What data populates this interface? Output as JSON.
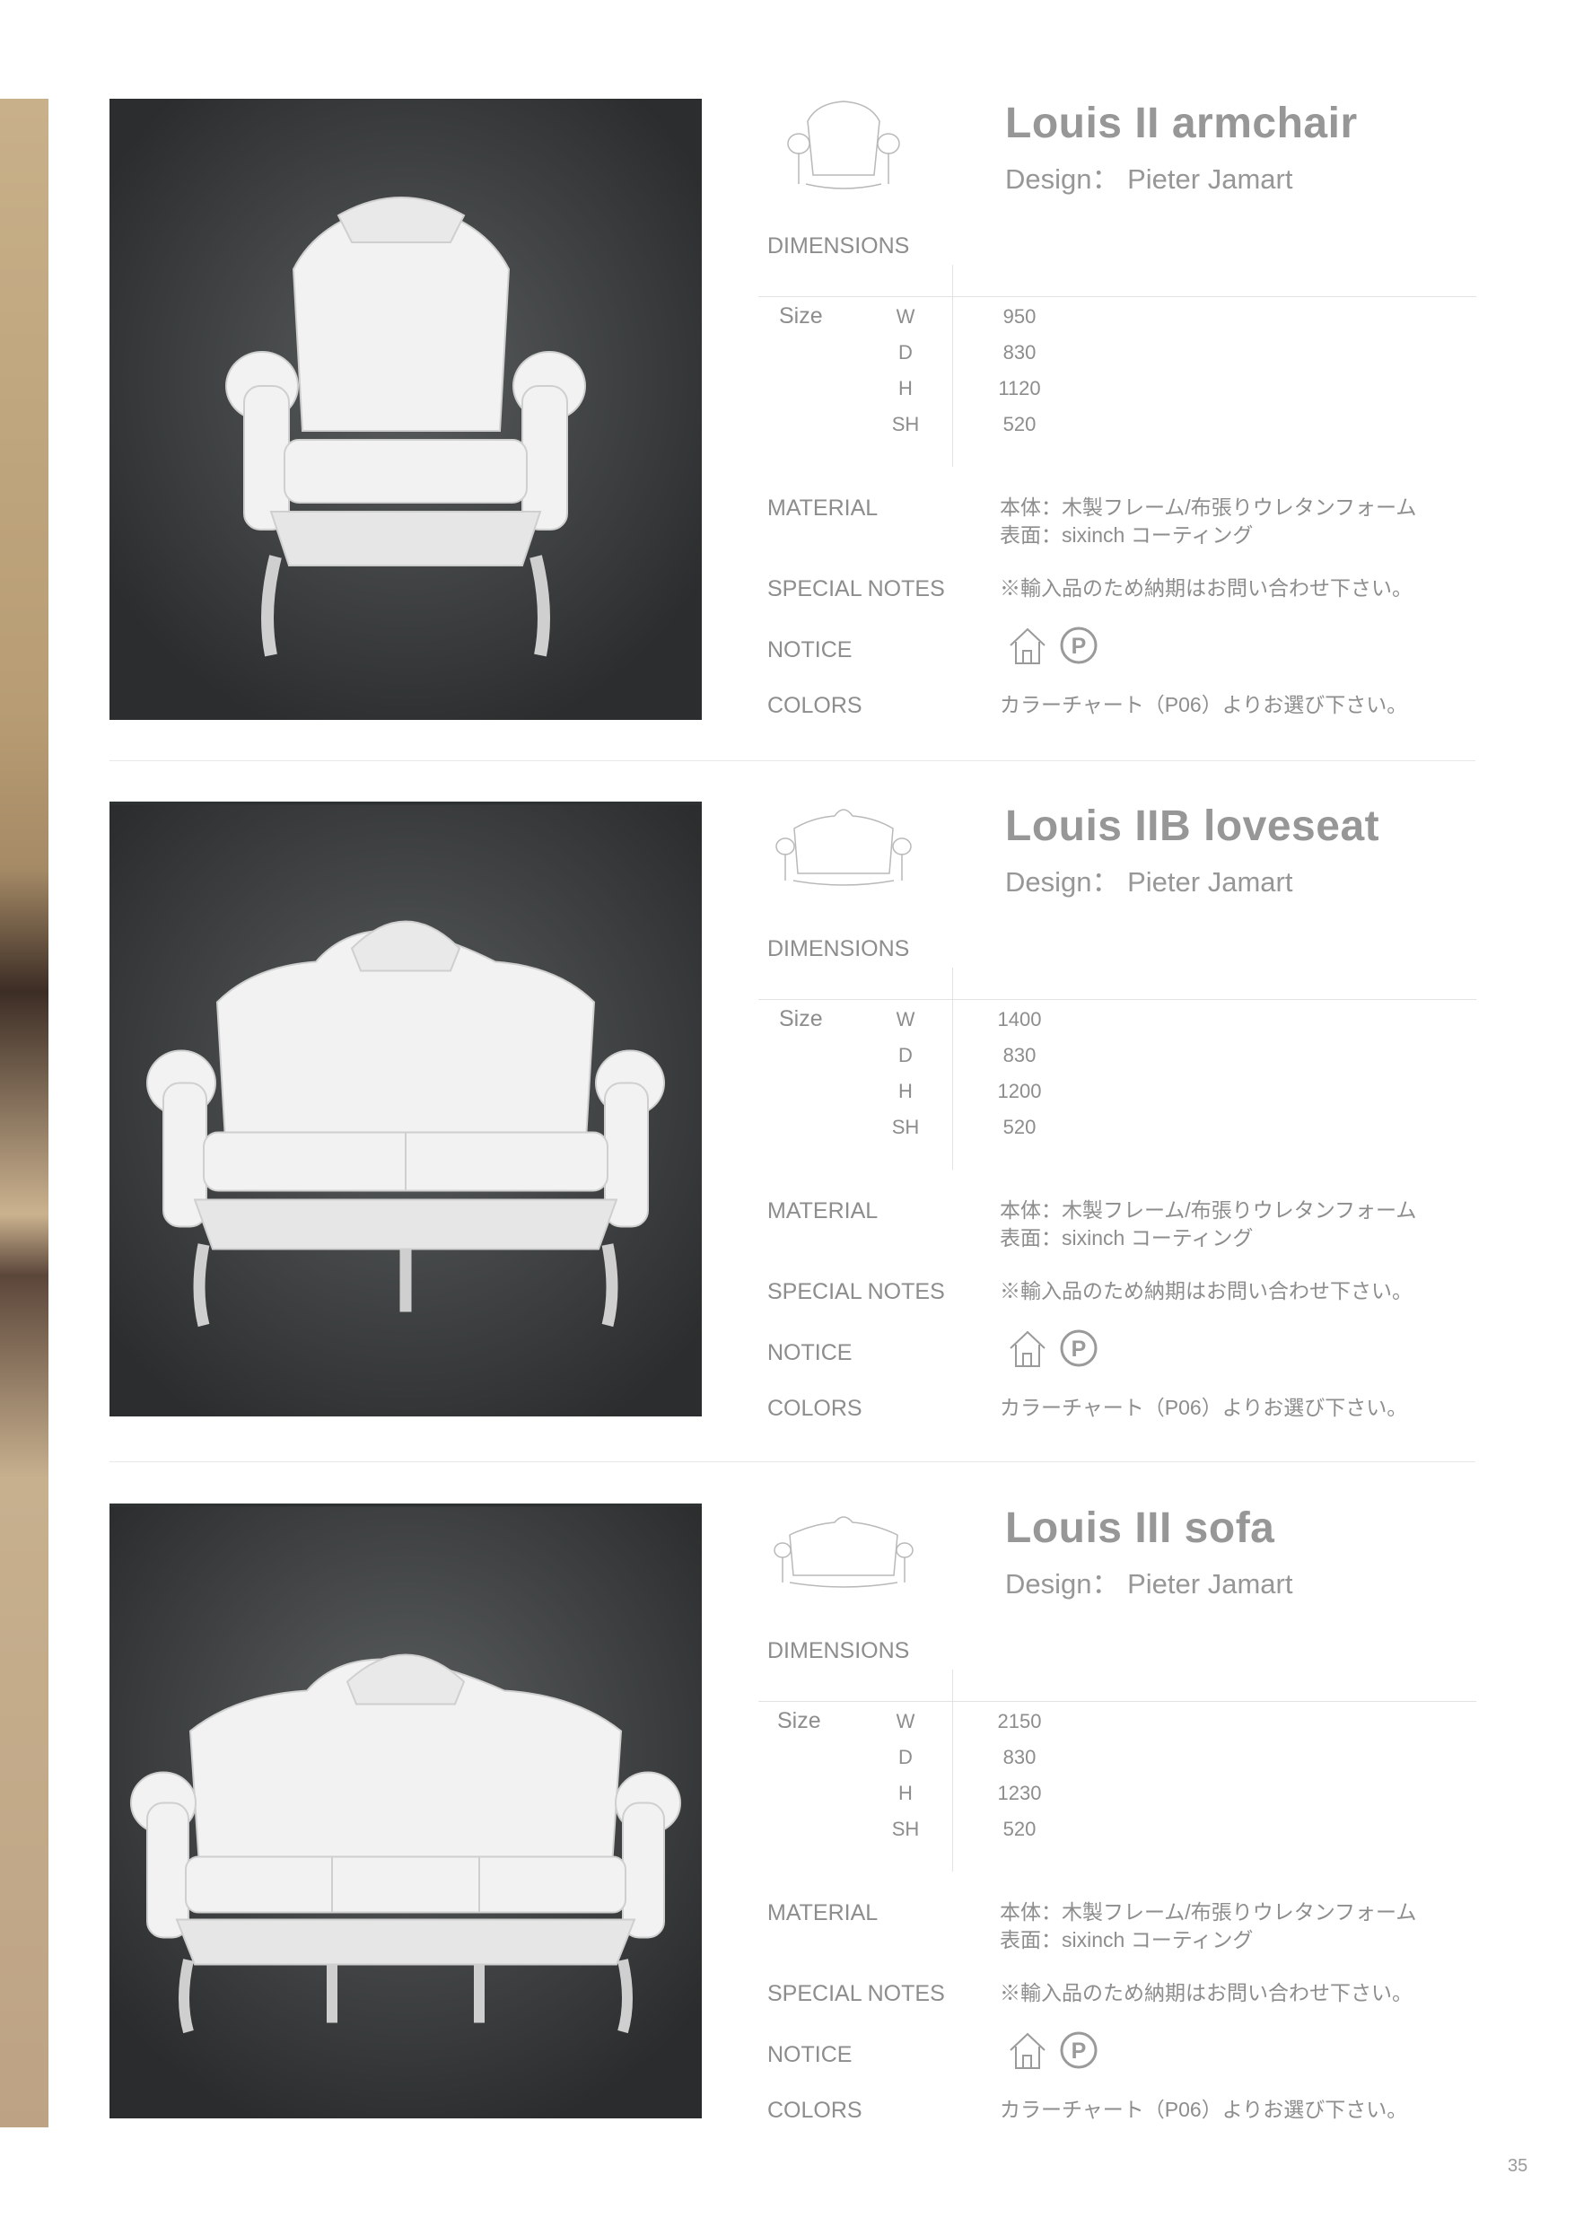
{
  "page_number": "35",
  "labels": {
    "dimensions": "DIMENSIONS",
    "size": "Size",
    "material": "MATERIAL",
    "special_notes": "SPECIAL NOTES",
    "notice": "NOTICE",
    "colors": "COLORS",
    "axes": [
      "W",
      "D",
      "H",
      "SH"
    ]
  },
  "products": [
    {
      "name": "Louis II armchair",
      "designer": "Design： Pieter Jamart",
      "sizes": [
        "950",
        "830",
        "1120",
        "520"
      ],
      "material_line1": "本体：木製フレーム/布張りウレタンフォーム",
      "material_line2": "表面：sixinch コーティング",
      "special_notes": "※輸入品のため納期はお問い合わせ下さい。",
      "colors": "カラーチャート（P06）よりお選び下さい。",
      "notice_icons": [
        "indoor-house-icon",
        "parking-p-icon"
      ]
    },
    {
      "name": "Louis IIB loveseat",
      "designer": "Design： Pieter Jamart",
      "sizes": [
        "1400",
        "830",
        "1200",
        "520"
      ],
      "material_line1": "本体：木製フレーム/布張りウレタンフォーム",
      "material_line2": "表面：sixinch コーティング",
      "special_notes": "※輸入品のため納期はお問い合わせ下さい。",
      "colors": "カラーチャート（P06）よりお選び下さい。",
      "notice_icons": [
        "indoor-house-icon",
        "parking-p-icon"
      ]
    },
    {
      "name": "Louis III sofa",
      "designer": "Design： Pieter Jamart",
      "sizes": [
        "2150",
        "830",
        "1230",
        "520"
      ],
      "material_line1": "本体：木製フレーム/布張りウレタンフォーム",
      "material_line2": "表面：sixinch コーティング",
      "special_notes": "※輸入品のため納期はお問い合わせ下さい。",
      "colors": "カラーチャート（P06）よりお選び下さい。",
      "notice_icons": [
        "indoor-house-icon",
        "parking-p-icon"
      ]
    }
  ]
}
